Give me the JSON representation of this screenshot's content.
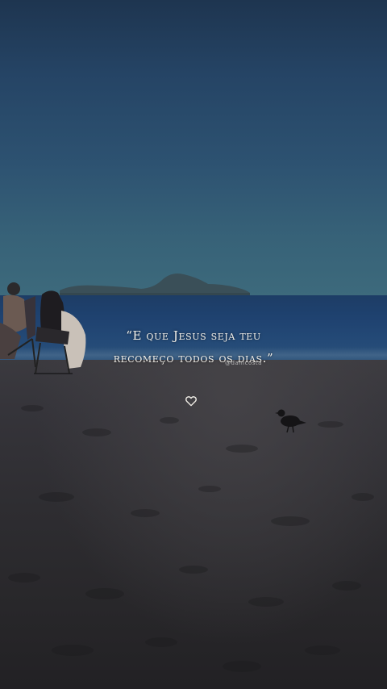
{
  "quote": {
    "line1": "“E que Jesus seja teu",
    "line2": "recomeço todos os dias.”"
  },
  "author_handle": "@danicosta",
  "icons": {
    "heart": "heart-outline-icon"
  },
  "colors": {
    "sky_top": "#1e3550",
    "sky_horizon": "#3d6a7c",
    "sea": "#1f4270",
    "sand": "#2e2d31",
    "text": "#f4f1ea"
  }
}
